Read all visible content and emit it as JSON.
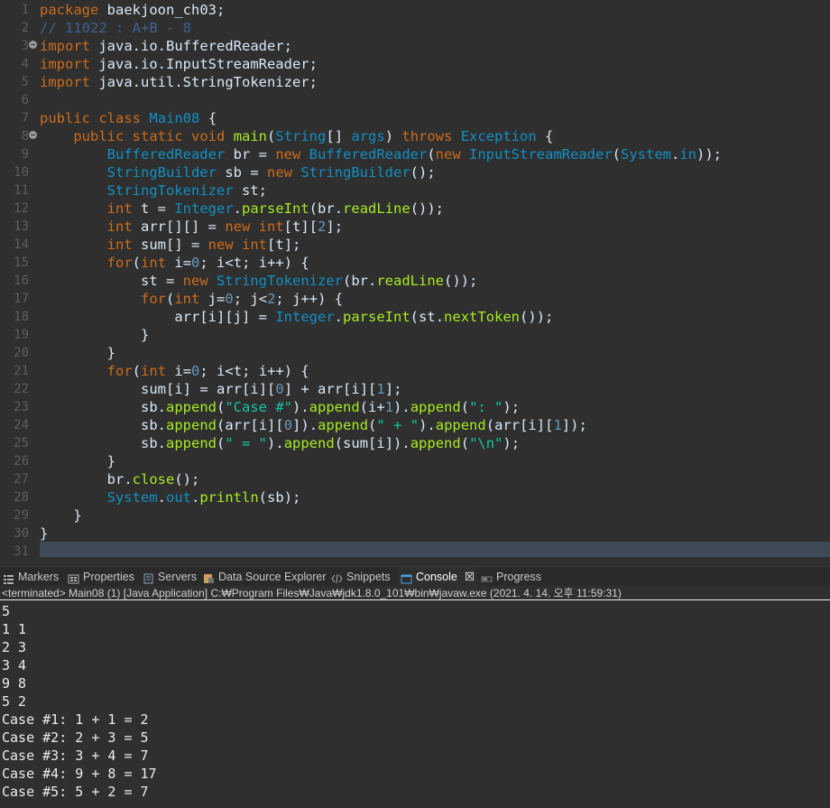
{
  "editor": {
    "line_numbers": [
      "1",
      "2",
      "3",
      "4",
      "5",
      "6",
      "7",
      "8",
      "9",
      "10",
      "11",
      "12",
      "13",
      "14",
      "15",
      "16",
      "17",
      "18",
      "19",
      "20",
      "21",
      "22",
      "23",
      "24",
      "25",
      "26",
      "27",
      "28",
      "29",
      "30",
      "31"
    ],
    "lines": [
      "package baekjoon_ch03;",
      "// 11022 : A+B - 8",
      "import java.io.BufferedReader;",
      "import java.io.InputStreamReader;",
      "import java.util.StringTokenizer;",
      "",
      "public class Main08 {",
      "    public static void main(String[] args) throws Exception {",
      "        BufferedReader br = new BufferedReader(new InputStreamReader(System.in));",
      "        StringBuilder sb = new StringBuilder();",
      "        StringTokenizer st;",
      "        int t = Integer.parseInt(br.readLine());",
      "        int arr[][] = new int[t][2];",
      "        int sum[] = new int[t];",
      "        for(int i=0; i<t; i++) {",
      "            st = new StringTokenizer(br.readLine());",
      "            for(int j=0; j<2; j++) {",
      "                arr[i][j] = Integer.parseInt(st.nextToken());",
      "            }",
      "        }",
      "        for(int i=0; i<t; i++) {",
      "            sum[i] = arr[i][0] + arr[i][1];",
      "            sb.append(\"Case #\").append(i+1).append(\": \");",
      "            sb.append(arr[i][0]).append(\" + \").append(arr[i][1]);",
      "            sb.append(\" = \").append(sum[i]).append(\"\\n\");",
      "        }",
      "        br.close();",
      "        System.out.println(sb);",
      "    }",
      "}",
      ""
    ]
  },
  "tabs": [
    {
      "label": "Markers",
      "icon": "markers-icon"
    },
    {
      "label": "Properties",
      "icon": "properties-icon"
    },
    {
      "label": "Servers",
      "icon": "servers-icon"
    },
    {
      "label": "Data Source Explorer",
      "icon": "data-source-icon"
    },
    {
      "label": "Snippets",
      "icon": "snippets-icon"
    },
    {
      "label": "Console",
      "icon": "console-icon",
      "close": "☒"
    },
    {
      "label": "Progress",
      "icon": "progress-icon"
    }
  ],
  "console": {
    "status": "<terminated> Main08 (1) [Java Application] C:₩Program Files₩Java₩jdk1.8.0_101₩bin₩javaw.exe (2021. 4. 14. 오후 11:59:31)",
    "output": [
      "5",
      "1 1",
      "2 3",
      "3 4",
      "9 8",
      "5 2",
      "Case #1: 1 + 1 = 2",
      "Case #2: 2 + 3 = 5",
      "Case #3: 3 + 4 = 7",
      "Case #4: 9 + 8 = 17",
      "Case #5: 5 + 2 = 7"
    ]
  },
  "colors": {
    "background": "#2f2f2f",
    "keyword": "#cc6c1d",
    "type": "#1290c3",
    "string": "#17c6a3",
    "method": "#a7ec21",
    "comment": "#41618f"
  }
}
